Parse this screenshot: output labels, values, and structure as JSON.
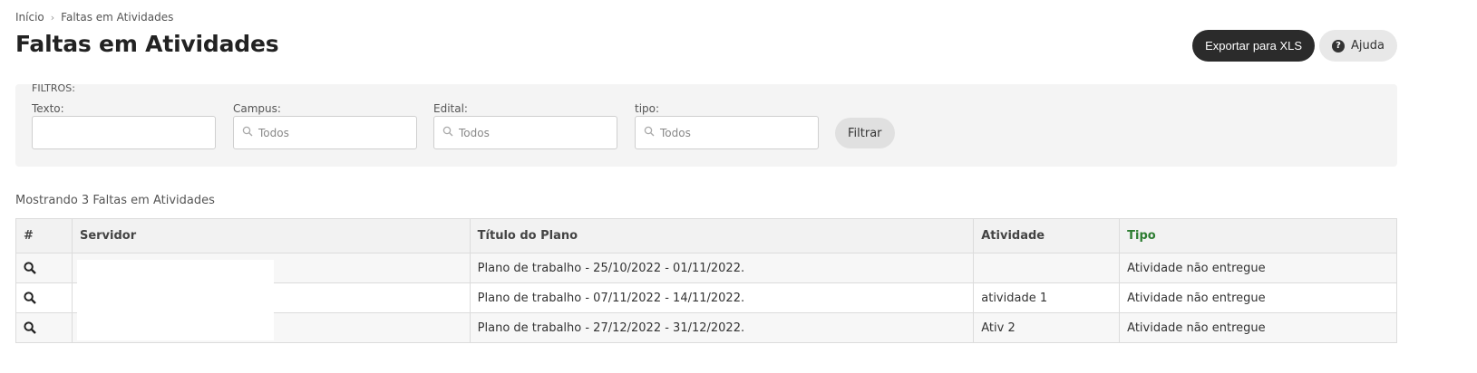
{
  "breadcrumb": {
    "home": "Início",
    "current": "Faltas em Atividades"
  },
  "page_title": "Faltas em Atividades",
  "actions": {
    "export_label": "Exportar para XLS",
    "help_label": "Ajuda"
  },
  "filters": {
    "section_label": "FILTROS:",
    "texto": {
      "label": "Texto:",
      "value": ""
    },
    "campus": {
      "label": "Campus:",
      "placeholder": "Todos"
    },
    "edital": {
      "label": "Edital:",
      "placeholder": "Todos"
    },
    "tipo": {
      "label": "tipo:",
      "placeholder": "Todos"
    },
    "submit_label": "Filtrar"
  },
  "result_count": "Mostrando 3 Faltas em Atividades",
  "table": {
    "headers": [
      "#",
      "Servidor",
      "Título do Plano",
      "Atividade",
      "Tipo"
    ],
    "sorted_column": "Tipo",
    "rows": [
      {
        "servidor": "",
        "titulo": "Plano de trabalho - 25/10/2022 - 01/11/2022.",
        "atividade": "",
        "tipo": "Atividade não entregue"
      },
      {
        "servidor": "",
        "titulo": "Plano de trabalho - 07/11/2022 - 14/11/2022.",
        "atividade": "atividade 1",
        "tipo": "Atividade não entregue"
      },
      {
        "servidor": "",
        "titulo": "Plano de trabalho - 27/12/2022 - 31/12/2022.",
        "atividade": "Ativ 2",
        "tipo": "Atividade não entregue"
      }
    ]
  },
  "colors": {
    "primary_button": "#2b2b2b",
    "sorted_header": "#2e7d32",
    "filter_panel": "#f4f4f4"
  }
}
